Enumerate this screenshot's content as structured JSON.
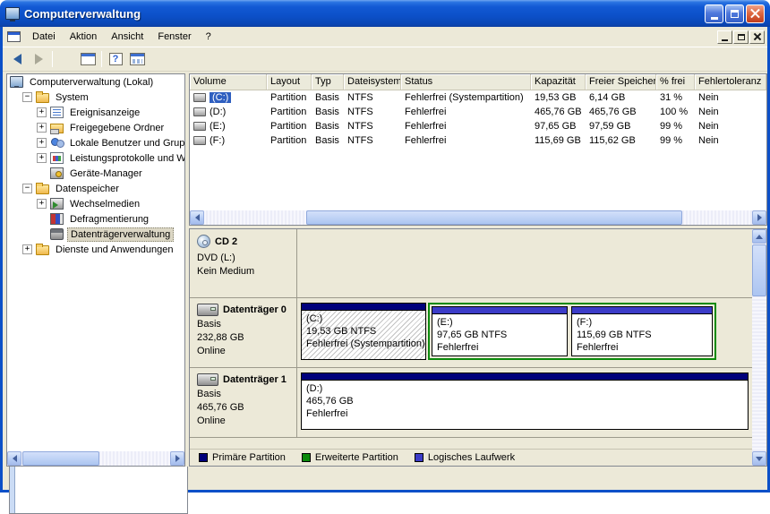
{
  "window": {
    "title": "Computerverwaltung"
  },
  "menu": {
    "items": [
      "Datei",
      "Aktion",
      "Ansicht",
      "Fenster",
      "?"
    ]
  },
  "toolbar": {
    "help_glyph": "?"
  },
  "tree": {
    "items": [
      {
        "label": "Computerverwaltung (Lokal)",
        "expander": ""
      },
      {
        "label": "System",
        "expander": "−"
      },
      {
        "label": "Ereignisanzeige",
        "expander": "+"
      },
      {
        "label": "Freigegebene Ordner",
        "expander": "+"
      },
      {
        "label": "Lokale Benutzer und Gruppen",
        "expander": "+"
      },
      {
        "label": "Leistungsprotokolle und Warnungen",
        "expander": "+"
      },
      {
        "label": "Geräte-Manager",
        "expander": ""
      },
      {
        "label": "Datenspeicher",
        "expander": "−"
      },
      {
        "label": "Wechselmedien",
        "expander": "+"
      },
      {
        "label": "Defragmentierung",
        "expander": ""
      },
      {
        "label": "Datenträgerverwaltung",
        "expander": ""
      },
      {
        "label": "Dienste und Anwendungen",
        "expander": "+"
      }
    ]
  },
  "volume_table": {
    "columns": [
      "Volume",
      "Layout",
      "Typ",
      "Dateisystem",
      "Status",
      "Kapazität",
      "Freier Speicher",
      "% frei",
      "Fehlertoleranz"
    ],
    "rows": [
      {
        "volume": "(C:)",
        "layout": "Partition",
        "typ": "Basis",
        "dateisystem": "NTFS",
        "status": "Fehlerfrei (Systempartition)",
        "kapazitaet": "19,53 GB",
        "freier_speicher": "6,14 GB",
        "prozent_frei": "31 %",
        "fehlertoleranz": "Nein"
      },
      {
        "volume": "(D:)",
        "layout": "Partition",
        "typ": "Basis",
        "dateisystem": "NTFS",
        "status": "Fehlerfrei",
        "kapazitaet": "465,76 GB",
        "freier_speicher": "465,76 GB",
        "prozent_frei": "100 %",
        "fehlertoleranz": "Nein"
      },
      {
        "volume": "(E:)",
        "layout": "Partition",
        "typ": "Basis",
        "dateisystem": "NTFS",
        "status": "Fehlerfrei",
        "kapazitaet": "97,65 GB",
        "freier_speicher": "97,59 GB",
        "prozent_frei": "99 %",
        "fehlertoleranz": "Nein"
      },
      {
        "volume": "(F:)",
        "layout": "Partition",
        "typ": "Basis",
        "dateisystem": "NTFS",
        "status": "Fehlerfrei",
        "kapazitaet": "115,69 GB",
        "freier_speicher": "115,62 GB",
        "prozent_frei": "99 %",
        "fehlertoleranz": "Nein"
      }
    ]
  },
  "graphical": {
    "cd": {
      "name": "CD 2",
      "drive": "DVD (L:)",
      "media": "Kein Medium"
    },
    "disks": [
      {
        "name": "Datenträger 0",
        "type": "Basis",
        "size": "232,88 GB",
        "status": "Online",
        "partitions": [
          {
            "label": "(C:)",
            "size": "19,53 GB NTFS",
            "status": "Fehlerfrei (Systempartition)",
            "color": "#00007B"
          },
          {
            "label": "(E:)",
            "size": "97,65 GB NTFS",
            "status": "Fehlerfrei",
            "color": "#3C3CC8"
          },
          {
            "label": "(F:)",
            "size": "115,69 GB NTFS",
            "status": "Fehlerfrei",
            "color": "#3C3CC8"
          }
        ]
      },
      {
        "name": "Datenträger 1",
        "type": "Basis",
        "size": "465,76 GB",
        "status": "Online",
        "partitions": [
          {
            "label": "(D:)",
            "size": "465,76 GB",
            "status": "Fehlerfrei",
            "color": "#00007B"
          }
        ]
      }
    ],
    "legend": [
      {
        "label": "Primäre Partition",
        "color": "#00007B"
      },
      {
        "label": "Erweiterte Partition",
        "color": "#0B8A0B"
      },
      {
        "label": "Logisches Laufwerk",
        "color": "#3C3CC8"
      }
    ]
  }
}
